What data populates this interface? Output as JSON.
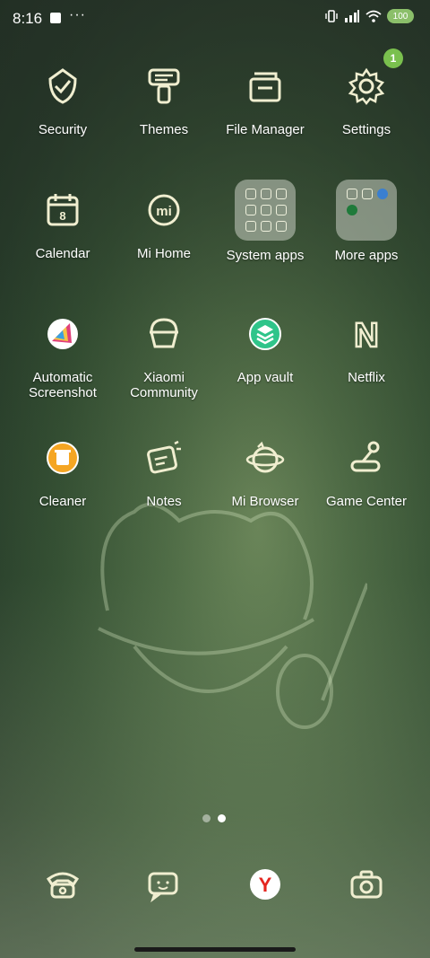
{
  "status": {
    "time": "8:16",
    "battery": "100",
    "more": "···"
  },
  "badge": "1",
  "apps": [
    {
      "label": "Security",
      "icon": "security-icon"
    },
    {
      "label": "Themes",
      "icon": "themes-icon"
    },
    {
      "label": "File Manager",
      "icon": "file-manager-icon"
    },
    {
      "label": "Settings",
      "icon": "settings-icon"
    },
    {
      "label": "Calendar",
      "icon": "calendar-icon",
      "day": "8"
    },
    {
      "label": "Mi Home",
      "icon": "mi-home-icon",
      "mark": "mi"
    },
    {
      "label": "System apps",
      "icon": "folder-icon"
    },
    {
      "label": "More apps",
      "icon": "folder-icon"
    },
    {
      "label": "Automatic Screenshot",
      "icon": "screenshot-icon"
    },
    {
      "label": "Xiaomi Community",
      "icon": "community-icon"
    },
    {
      "label": "App vault",
      "icon": "app-vault-icon"
    },
    {
      "label": "Netflix",
      "icon": "netflix-icon",
      "mark": "N"
    },
    {
      "label": "Cleaner",
      "icon": "cleaner-icon"
    },
    {
      "label": "Notes",
      "icon": "notes-icon"
    },
    {
      "label": "Mi Browser",
      "icon": "browser-icon"
    },
    {
      "label": "Game Center",
      "icon": "game-center-icon"
    }
  ],
  "dock": [
    {
      "icon": "phone-icon"
    },
    {
      "icon": "messages-icon"
    },
    {
      "icon": "yandex-browser-icon",
      "mark": "Y"
    },
    {
      "icon": "camera-icon"
    }
  ],
  "colors": {
    "icon_line": "#f0eed0",
    "badge": "#7ac04e",
    "app_vault": "#2fc48a",
    "cleaner": "#f5a623"
  }
}
